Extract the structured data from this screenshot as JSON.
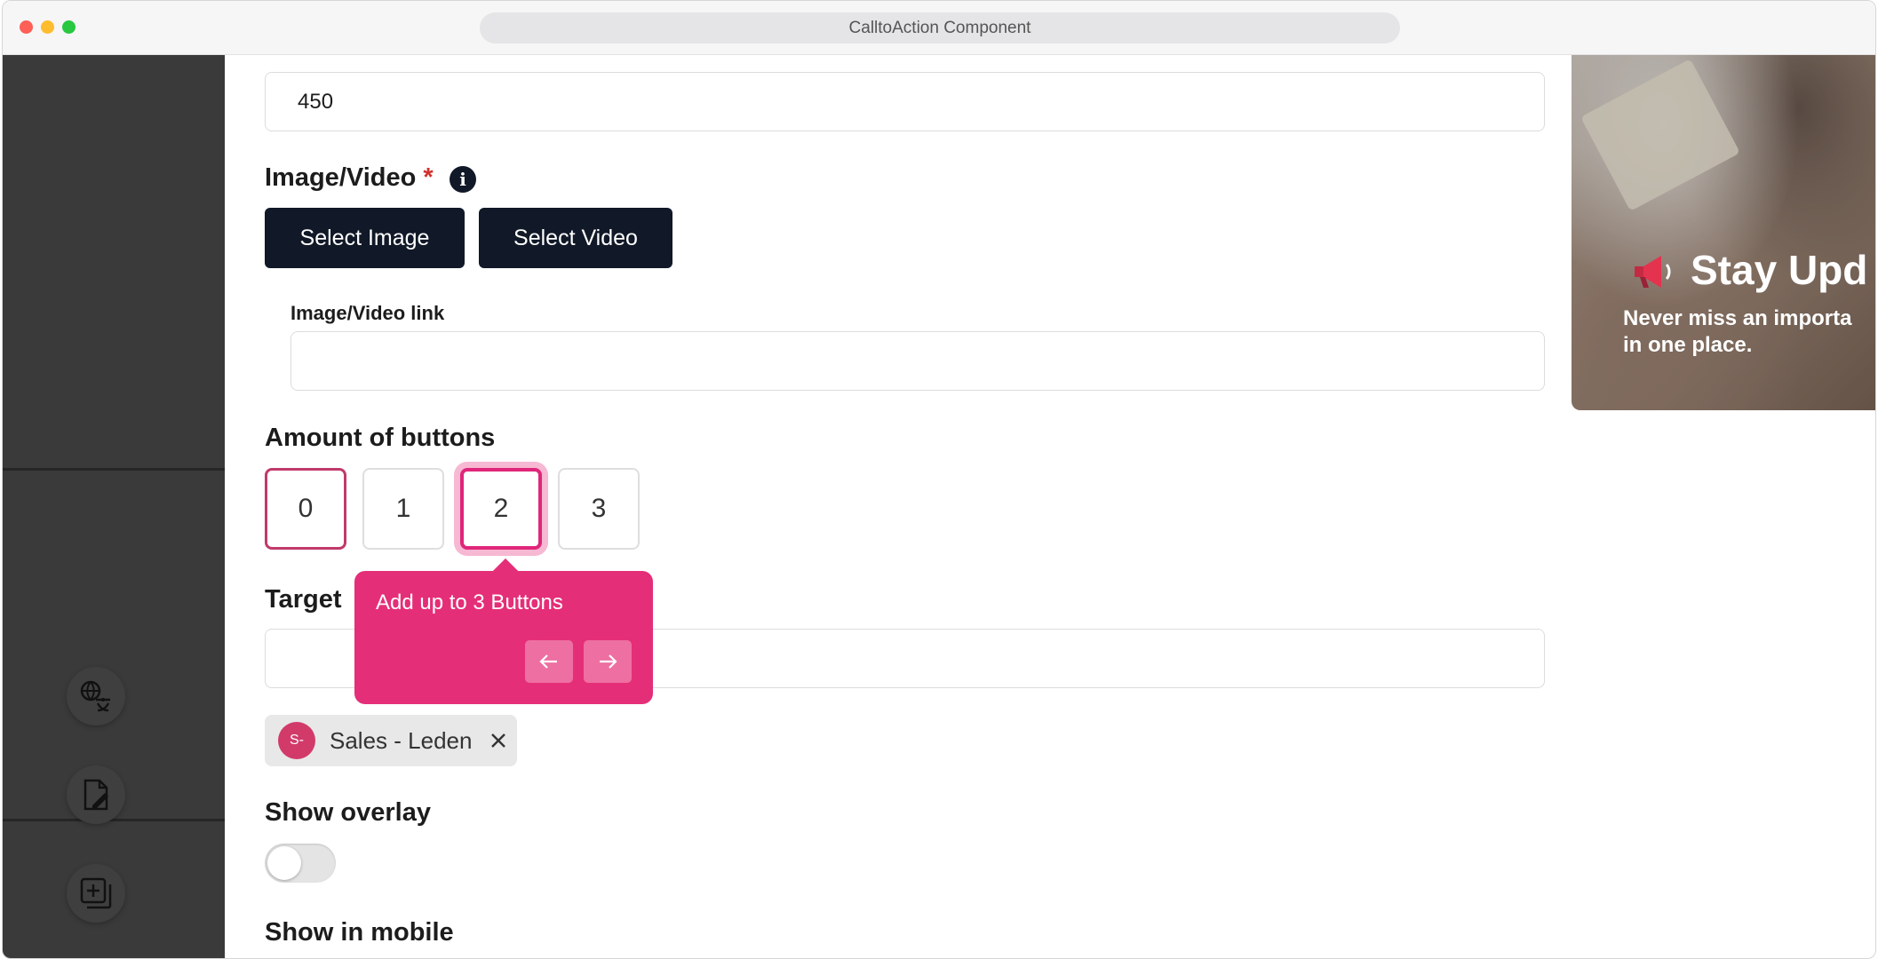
{
  "window": {
    "title": "CalltoAction Component"
  },
  "form": {
    "height_value": "450",
    "image_video": {
      "label": "Image/Video",
      "required_mark": "*",
      "info": "i",
      "select_image": "Select Image",
      "select_video": "Select Video",
      "link_label": "Image/Video link",
      "link_value": ""
    },
    "buttons": {
      "label": "Amount of buttons",
      "options": [
        "0",
        "1",
        "2",
        "3"
      ],
      "selected": "2"
    },
    "tooltip": {
      "text": "Add up to 3 Buttons"
    },
    "target": {
      "label": "Target",
      "value": ""
    },
    "chip": {
      "initials": "S-",
      "label": "Sales - Leden"
    },
    "overlay": {
      "label": "Show overlay",
      "enabled": false
    },
    "mobile": {
      "label": "Show in mobile"
    }
  },
  "preview": {
    "title": "Stay Upd",
    "subtitle_line1": "Never miss an importa",
    "subtitle_line2": "in one place."
  },
  "colors": {
    "accent": "#e52e78",
    "dark_button": "#111827",
    "sidebar": "#3a3a3a"
  },
  "icons": [
    "translate-icon",
    "edit-document-icon",
    "add-copy-icon",
    "arrow-left-icon",
    "arrow-right-icon",
    "close-icon",
    "megaphone-icon",
    "info-icon"
  ]
}
